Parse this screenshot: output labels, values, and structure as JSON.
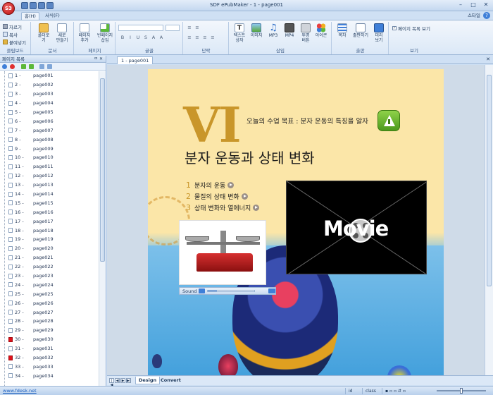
{
  "app": {
    "title": "SDF ePubMaker - 1 - page001",
    "logo": "S3"
  },
  "window_controls": [
    "minimize-icon",
    "maximize-icon",
    "close-icon"
  ],
  "ribbon_tabs": [
    {
      "label": "홈(H)",
      "active": true
    },
    {
      "label": "서식(F)",
      "active": false
    }
  ],
  "style_link": "스타일",
  "ribbon": {
    "clipboard": {
      "label": "클립보드",
      "cut": "자르기",
      "copy": "복사",
      "paste": "붙여넣기"
    },
    "document": {
      "label": "문서",
      "open_folder": "폴더로기",
      "new": "새로\n만들기"
    },
    "page": {
      "label": "페이지",
      "add_page": "페이지\n추가",
      "insert_blank": "빈페이지\n삽입"
    },
    "font": {
      "label": "글꼴"
    },
    "paragraph": {
      "label": "단락"
    },
    "insert": {
      "label": "삽입",
      "text_box": "텍스트\n상자",
      "image": "이미지",
      "mp3": "MP3",
      "mp4": "MP4",
      "transparent_button": "투명\n버튼",
      "icon": "아이콘"
    },
    "publish": {
      "label": "출판",
      "toc": "목차",
      "publish": "출판하기",
      "preview": "미리\n보기"
    },
    "view": {
      "label": "보기",
      "show_page_list": "페이지 목록 보기",
      "checked": true
    }
  },
  "page_panel": {
    "title": "페이지 목록",
    "controls": "ㅁ ✕",
    "pages": [
      {
        "num": "1 -",
        "name": "page001",
        "red": false
      },
      {
        "num": "2 -",
        "name": "page002",
        "red": false
      },
      {
        "num": "3 -",
        "name": "page003",
        "red": false
      },
      {
        "num": "4 -",
        "name": "page004",
        "red": false
      },
      {
        "num": "5 -",
        "name": "page005",
        "red": false
      },
      {
        "num": "6 -",
        "name": "page006",
        "red": false
      },
      {
        "num": "7 -",
        "name": "page007",
        "red": false
      },
      {
        "num": "8 -",
        "name": "page008",
        "red": false
      },
      {
        "num": "9 -",
        "name": "page009",
        "red": false
      },
      {
        "num": "10 -",
        "name": "page010",
        "red": false
      },
      {
        "num": "11 -",
        "name": "page011",
        "red": false
      },
      {
        "num": "12 -",
        "name": "page012",
        "red": false
      },
      {
        "num": "13 -",
        "name": "page013",
        "red": false
      },
      {
        "num": "14 -",
        "name": "page014",
        "red": false
      },
      {
        "num": "15 -",
        "name": "page015",
        "red": false
      },
      {
        "num": "16 -",
        "name": "page016",
        "red": false
      },
      {
        "num": "17 -",
        "name": "page017",
        "red": false
      },
      {
        "num": "18 -",
        "name": "page018",
        "red": false
      },
      {
        "num": "19 -",
        "name": "page019",
        "red": false
      },
      {
        "num": "20 -",
        "name": "page020",
        "red": false
      },
      {
        "num": "21 -",
        "name": "page021",
        "red": false
      },
      {
        "num": "22 -",
        "name": "page022",
        "red": false
      },
      {
        "num": "23 -",
        "name": "page023",
        "red": false
      },
      {
        "num": "24 -",
        "name": "page024",
        "red": false
      },
      {
        "num": "25 -",
        "name": "page025",
        "red": false
      },
      {
        "num": "26 -",
        "name": "page026",
        "red": false
      },
      {
        "num": "27 -",
        "name": "page027",
        "red": false
      },
      {
        "num": "28 -",
        "name": "page028",
        "red": false
      },
      {
        "num": "29 -",
        "name": "page029",
        "red": false
      },
      {
        "num": "30 -",
        "name": "page030",
        "red": true
      },
      {
        "num": "31 -",
        "name": "page031",
        "red": false
      },
      {
        "num": "32 -",
        "name": "page032",
        "red": true
      },
      {
        "num": "33 -",
        "name": "page033",
        "red": false
      },
      {
        "num": "34 -",
        "name": "page034",
        "red": false
      }
    ]
  },
  "doc_tab": {
    "label": "1 - page001",
    "close": "✕"
  },
  "page_content": {
    "numeral": "VI",
    "lesson_goal": "오늘의 수업 목표 : 분자 운동의 특징을 알자",
    "chapter_title": "분자 운동과 상태 변화",
    "toc": [
      {
        "n": "1",
        "text": "분자의 운동"
      },
      {
        "n": "2",
        "text": "물질의 상태 변화"
      },
      {
        "n": "3",
        "text": "상태 변화와 열에너지"
      }
    ],
    "sound_label": "Sound",
    "movie_label": "Movie"
  },
  "view_tabs": [
    {
      "label": "Design",
      "active": true
    },
    {
      "label": "Convert",
      "active": false
    }
  ],
  "status": {
    "link": "www.fdesk.net",
    "cells": [
      "id",
      "class"
    ]
  }
}
